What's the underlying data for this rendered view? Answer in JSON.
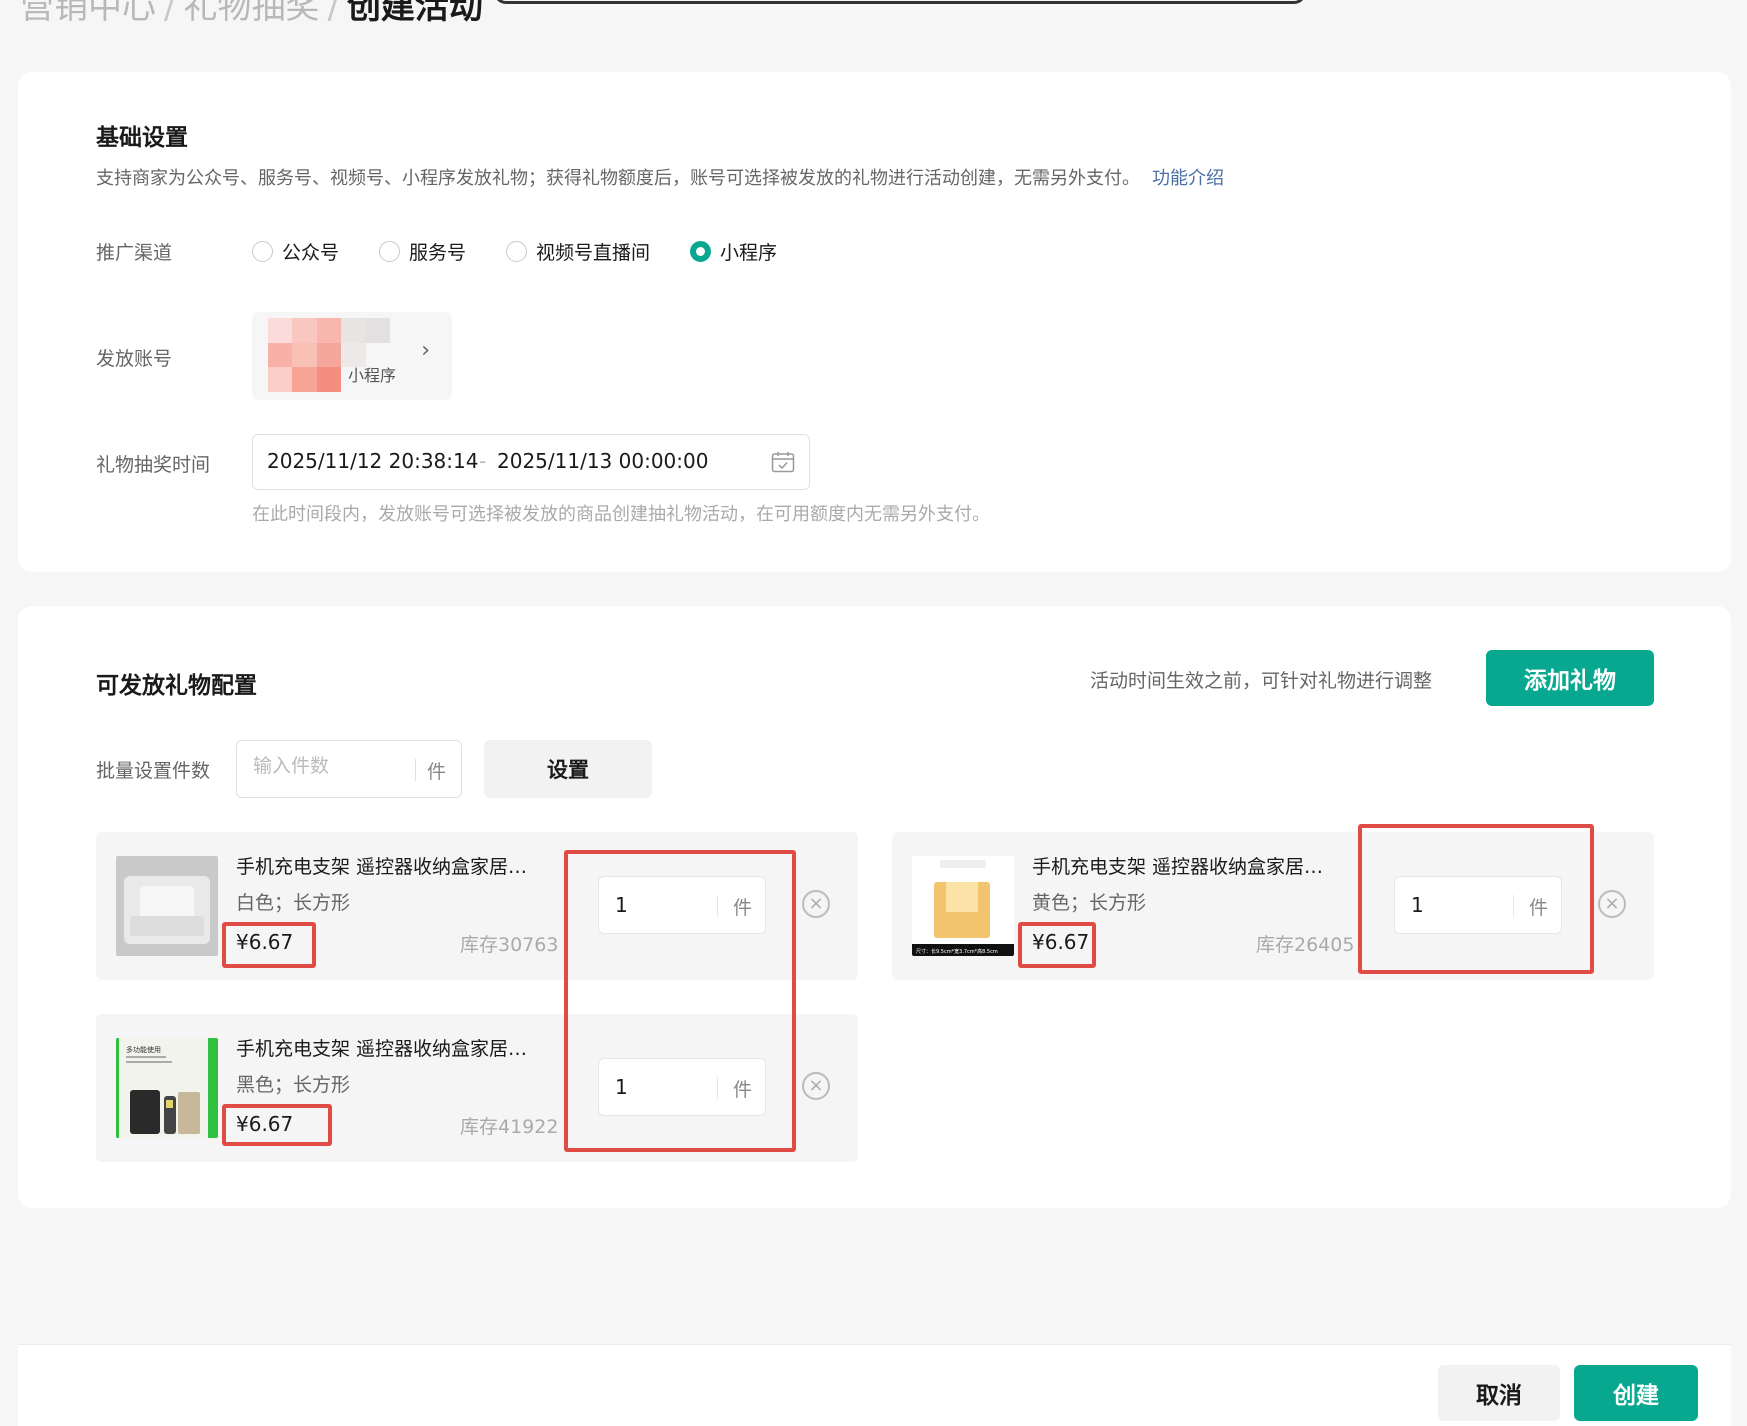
{
  "breadcrumb": {
    "level1": "营销中心",
    "level2": "礼物抽奖",
    "current": "创建活动",
    "separator": "/"
  },
  "basic": {
    "title": "基础设置",
    "desc": "支持商家为公众号、服务号、视频号、小程序发放礼物；获得礼物额度后，账号可选择被发放的礼物进行活动创建，无需另外支付。",
    "link": "功能介绍",
    "channel_label": "推广渠道",
    "channels": [
      {
        "label": "公众号",
        "selected": false
      },
      {
        "label": "服务号",
        "selected": false
      },
      {
        "label": "视频号直播间",
        "selected": false
      },
      {
        "label": "小程序",
        "selected": true
      }
    ],
    "account_label": "发放账号",
    "account_tag": "小程序",
    "time_label": "礼物抽奖时间",
    "start_time": "2025/11/12 20:38:14",
    "end_time": "2025/11/13 00:00:00",
    "time_sep": "-",
    "time_hint": "在此时间段内，发放账号可选择被发放的商品创建抽礼物活动，在可用额度内无需另外支付。"
  },
  "gifts": {
    "title": "可发放礼物配置",
    "hint": "活动时间生效之前，可针对礼物进行调整",
    "add_button": "添加礼物",
    "batch_label": "批量设置件数",
    "batch_placeholder": "输入件数",
    "unit": "件",
    "set_button": "设置",
    "items": [
      {
        "name": "手机充电支架 遥控器收纳盒家居…",
        "spec": "白色；长方形",
        "price": "¥6.67",
        "stock": "库存30763",
        "qty": "1"
      },
      {
        "name": "手机充电支架 遥控器收纳盒家居…",
        "spec": "黄色；长方形",
        "price": "¥6.67",
        "stock": "库存26405",
        "qty": "1"
      },
      {
        "name": "手机充电支架 遥控器收纳盒家居…",
        "spec": "黑色；长方形",
        "price": "¥6.67",
        "stock": "库存41922",
        "qty": "1"
      }
    ],
    "thumb2_text": "尺寸：长9.5cm*宽3.7cm*高8.5cm",
    "thumb3_text": "多功能使用"
  },
  "footer": {
    "cancel": "取消",
    "create": "创建"
  },
  "colors": {
    "accent": "#07a88f",
    "highlight": "#e14b45",
    "link": "#4a6fa5"
  }
}
